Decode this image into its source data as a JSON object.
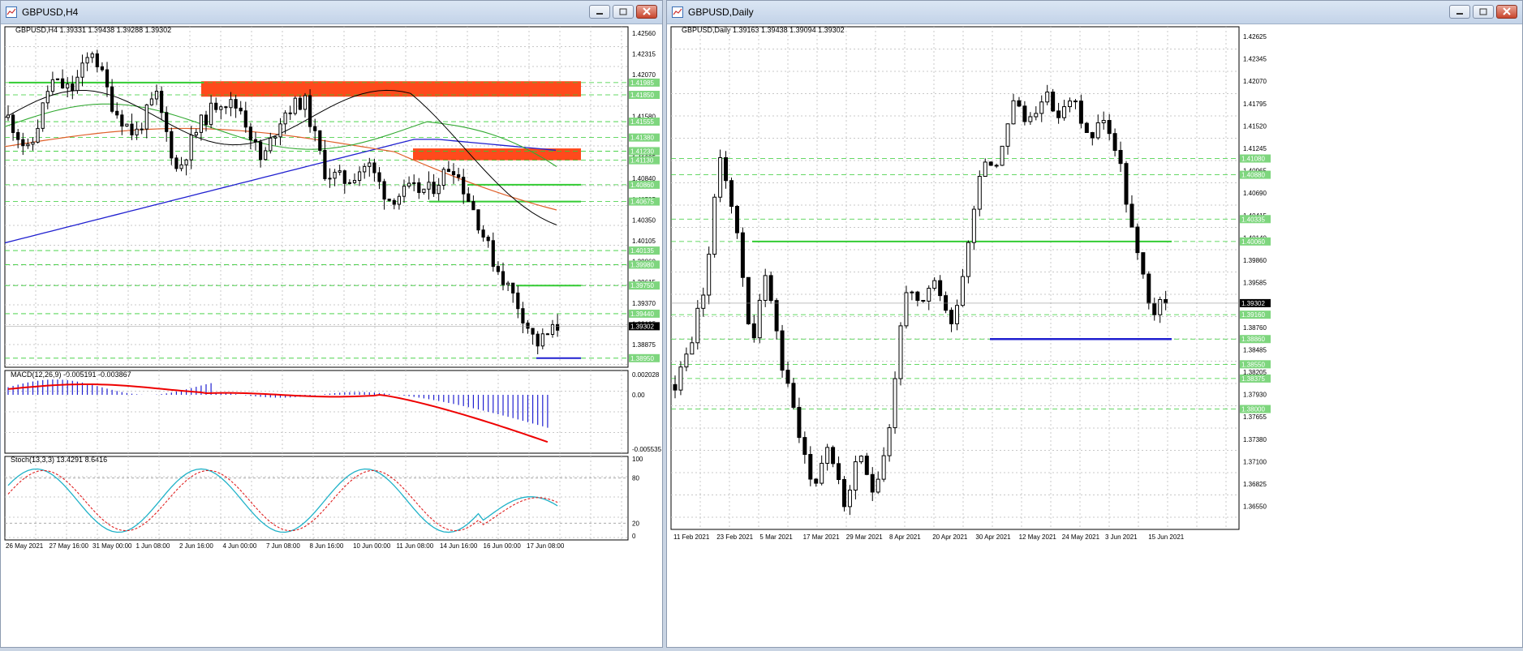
{
  "left_window": {
    "title": "GBPUSD,H4",
    "header": "GBPUSD,H4  1.39331 1.39438 1.39288 1.39302",
    "price_ticks": [
      "1.42560",
      "1.42315",
      "1.42070",
      "1.41825",
      "1.41580",
      "1.41335",
      "1.41085",
      "1.40840",
      "1.40595",
      "1.40350",
      "1.40105",
      "1.39860",
      "1.39615",
      "1.39370",
      "1.39125",
      "1.38875"
    ],
    "level_labels": [
      "1.41985",
      "1.41850",
      "1.41555",
      "1.41380",
      "1.41230",
      "1.41130",
      "1.40860",
      "1.40675",
      "1.40135",
      "1.39980",
      "1.39750",
      "1.39440",
      "1.38950"
    ],
    "current_price": "1.39302",
    "macd_header": "MACD(12,26,9) -0.005191 -0.003867",
    "macd_ticks": [
      "0.002028",
      "0.00",
      "-0.005535"
    ],
    "stoch_header": "Stoch(13,3,3) 13.4291 8.6416",
    "stoch_ticks": [
      "100",
      "80",
      "20",
      "0"
    ],
    "time_labels": [
      "26 May 2021",
      "27 May 16:00",
      "31 May 00:00",
      "1 Jun 08:00",
      "2 Jun 16:00",
      "4 Jun 00:00",
      "7 Jun 08:00",
      "8 Jun 16:00",
      "10 Jun 00:00",
      "11 Jun 08:00",
      "14 Jun 16:00",
      "16 Jun 00:00",
      "17 Jun 08:00"
    ]
  },
  "right_window": {
    "title": "GBPUSD,Daily",
    "header": "GBPUSD,Daily  1.39163 1.39438 1.39094 1.39302",
    "price_ticks": [
      "1.42625",
      "1.42345",
      "1.42070",
      "1.41795",
      "1.41520",
      "1.41245",
      "1.40965",
      "1.40690",
      "1.40415",
      "1.40140",
      "1.39860",
      "1.39585",
      "1.39035",
      "1.38760",
      "1.38485",
      "1.38205",
      "1.37930",
      "1.37655",
      "1.37380",
      "1.37100",
      "1.36825",
      "1.36550"
    ],
    "level_labels": [
      "1.41080",
      "1.40880",
      "1.40335",
      "1.40060",
      "1.39160",
      "1.38860",
      "1.38550",
      "1.38375",
      "1.38000"
    ],
    "current_price": "1.39302",
    "time_labels": [
      "11 Feb 2021",
      "23 Feb 2021",
      "5 Mar 2021",
      "17 Mar 2021",
      "29 Mar 2021",
      "8 Apr 2021",
      "20 Apr 2021",
      "30 Apr 2021",
      "12 May 2021",
      "24 May 2021",
      "3 Jun 2021",
      "15 Jun 2021"
    ]
  },
  "colors": {
    "up": "#ffffff",
    "down": "#000000",
    "zone": "#ff4a1c",
    "level": "#33cc33",
    "blue": "#2020d0",
    "macd_signal": "#ee0000",
    "stoch_main": "#20b2c8",
    "stoch_signal": "#e02020"
  }
}
